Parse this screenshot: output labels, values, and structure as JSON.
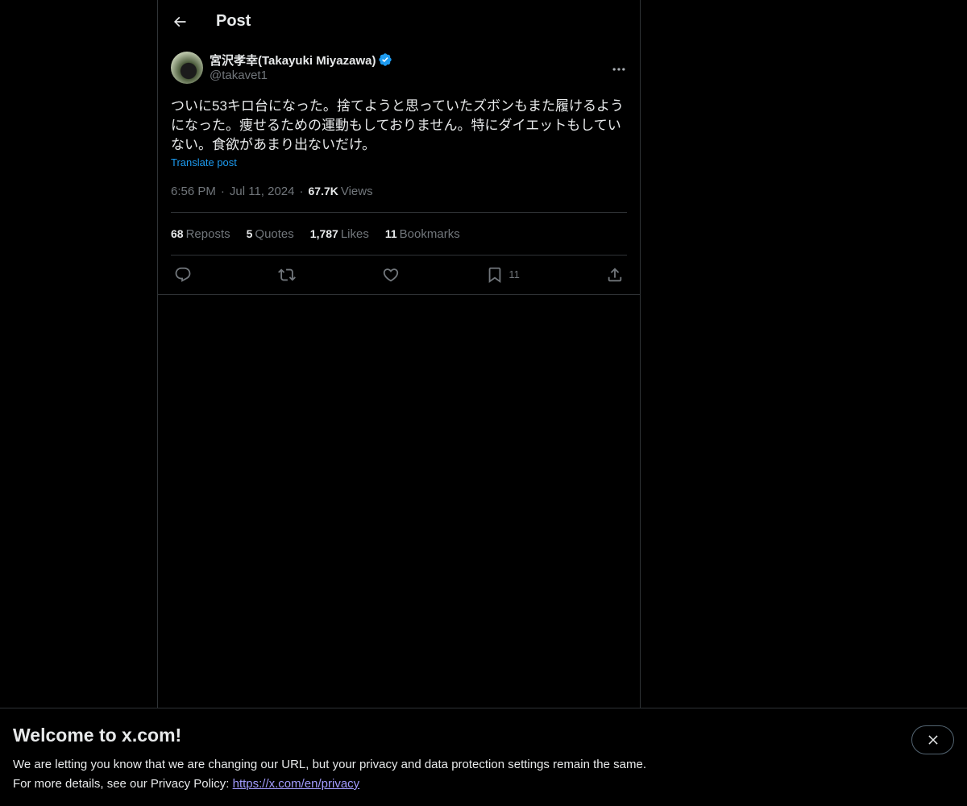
{
  "header": {
    "title": "Post"
  },
  "post": {
    "author": {
      "display_name": "宮沢孝幸(Takayuki Miyazawa)",
      "handle": "@takavet1",
      "verified_color": "#1d9bf0"
    },
    "text": "ついに53キロ台になった。捨てようと思っていたズボンもまた履けるようになった。痩せるための運動もしておりません。特にダイエットもしていない。食欲があまり出ないだけ。",
    "translate_label": "Translate post",
    "time": "6:56 PM",
    "date": "Jul 11, 2024",
    "views_count": "67.7K",
    "views_label": "Views",
    "stats": [
      {
        "num": "68",
        "label": "Reposts"
      },
      {
        "num": "5",
        "label": "Quotes"
      },
      {
        "num": "1,787",
        "label": "Likes"
      },
      {
        "num": "11",
        "label": "Bookmarks"
      }
    ],
    "actions": {
      "reply_icon": "reply-icon",
      "repost_icon": "repost-icon",
      "like_icon": "heart-icon",
      "bookmark_icon": "bookmark-icon",
      "bookmark_count": "11",
      "share_icon": "share-icon"
    }
  },
  "banner": {
    "title": "Welcome to x.com!",
    "line1": "We are letting you know that we are changing our URL, but your privacy and data protection settings remain the same.",
    "line2_prefix": "For more details, see our Privacy Policy:",
    "link_text": "https://x.com/en/privacy"
  },
  "colors": {
    "background": "#000000",
    "border": "#2f3336",
    "accent": "#1d9bf0",
    "muted": "#71767b"
  }
}
